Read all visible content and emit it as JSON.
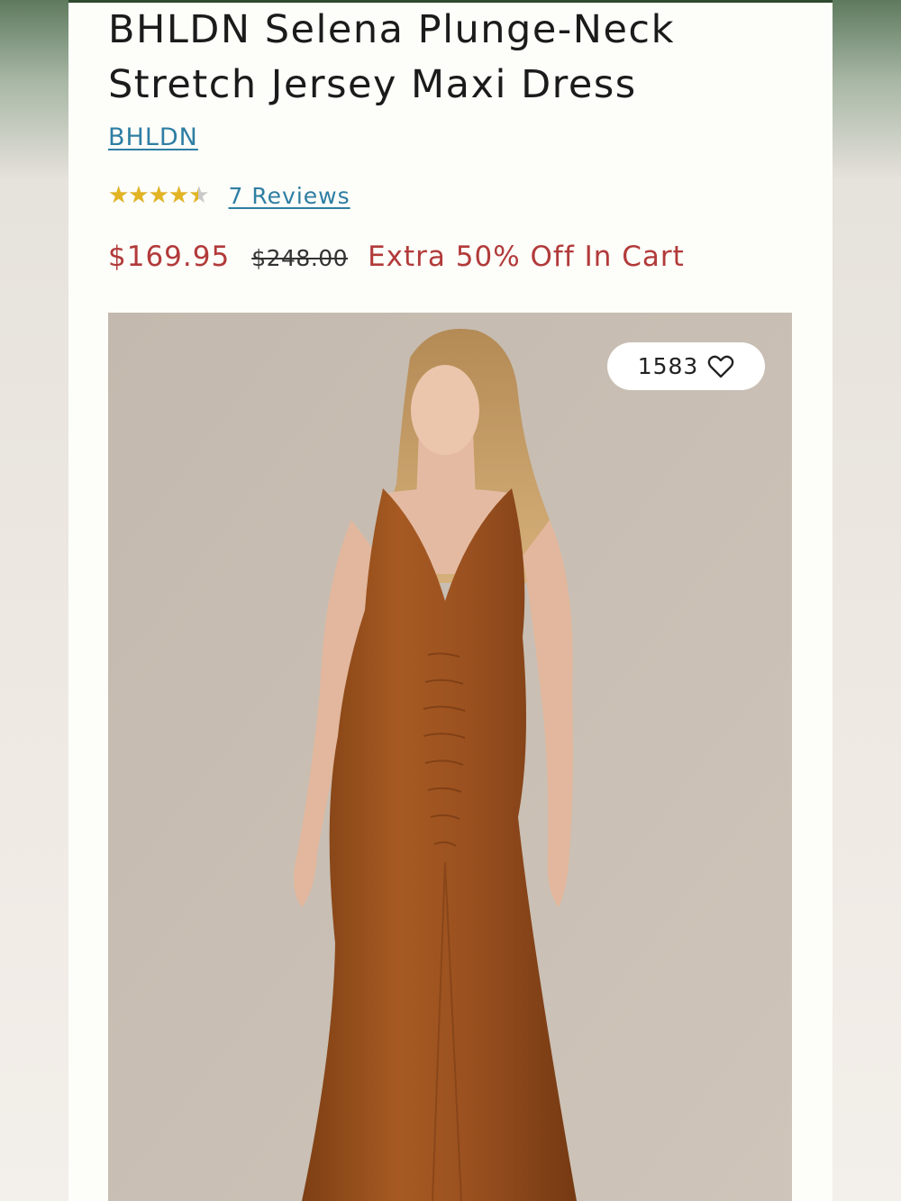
{
  "product": {
    "title": "BHLDN Selena Plunge-Neck Stretch Jersey Maxi Dress",
    "brand": "BHLDN",
    "rating": {
      "stars": "★★★★★",
      "value_fraction": 0.9,
      "reviews_label": "7 Reviews"
    },
    "price": {
      "sale": "$169.95",
      "original": "$248.00",
      "promo": "Extra 50% Off In Cart"
    },
    "image": {
      "favorites_count": "1583",
      "favorite_icon": "heart-outline-icon"
    }
  },
  "colors": {
    "brand_link": "#2e7ea3",
    "sale_red": "#b23a3a",
    "star_gold": "#e2b424",
    "dress": "#a0561f",
    "image_backdrop": "#c9bfb4"
  }
}
